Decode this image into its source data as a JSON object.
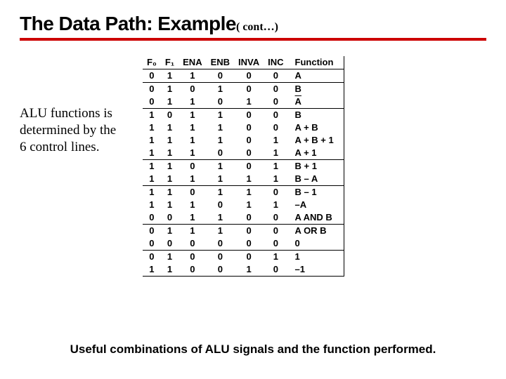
{
  "title": {
    "main": "The Data Path: Example",
    "cont": "( cont…)"
  },
  "sidetext": "ALU functions is determined by the 6 control lines.",
  "table": {
    "headers": [
      "F₀",
      "F₁",
      "ENA",
      "ENB",
      "INVA",
      "INC",
      "Function"
    ],
    "rows": [
      [
        "0",
        "1",
        "1",
        "0",
        "0",
        "0",
        "A"
      ],
      [
        "0",
        "1",
        "0",
        "1",
        "0",
        "0",
        "B"
      ],
      [
        "0",
        "1",
        "1",
        "0",
        "1",
        "0",
        "A_bar"
      ],
      [
        "1",
        "0",
        "1",
        "1",
        "0",
        "0",
        "B"
      ],
      [
        "1",
        "1",
        "1",
        "1",
        "0",
        "0",
        "A + B"
      ],
      [
        "1",
        "1",
        "1",
        "1",
        "0",
        "1",
        "A + B + 1"
      ],
      [
        "1",
        "1",
        "1",
        "0",
        "0",
        "1",
        "A + 1"
      ],
      [
        "1",
        "1",
        "0",
        "1",
        "0",
        "1",
        "B + 1"
      ],
      [
        "1",
        "1",
        "1",
        "1",
        "1",
        "1",
        "B – A"
      ],
      [
        "1",
        "1",
        "0",
        "1",
        "1",
        "0",
        "B – 1"
      ],
      [
        "1",
        "1",
        "1",
        "0",
        "1",
        "1",
        "–A"
      ],
      [
        "0",
        "0",
        "1",
        "1",
        "0",
        "0",
        "A AND B"
      ],
      [
        "0",
        "1",
        "1",
        "1",
        "0",
        "0",
        "A OR B"
      ],
      [
        "0",
        "0",
        "0",
        "0",
        "0",
        "0",
        "0"
      ],
      [
        "0",
        "1",
        "0",
        "0",
        "0",
        "1",
        "1"
      ],
      [
        "1",
        "1",
        "0",
        "0",
        "1",
        "0",
        "–1"
      ]
    ],
    "group_sizes": [
      1,
      2,
      4,
      2,
      3,
      2,
      2
    ]
  },
  "caption": "Useful combinations of ALU signals and the function performed."
}
